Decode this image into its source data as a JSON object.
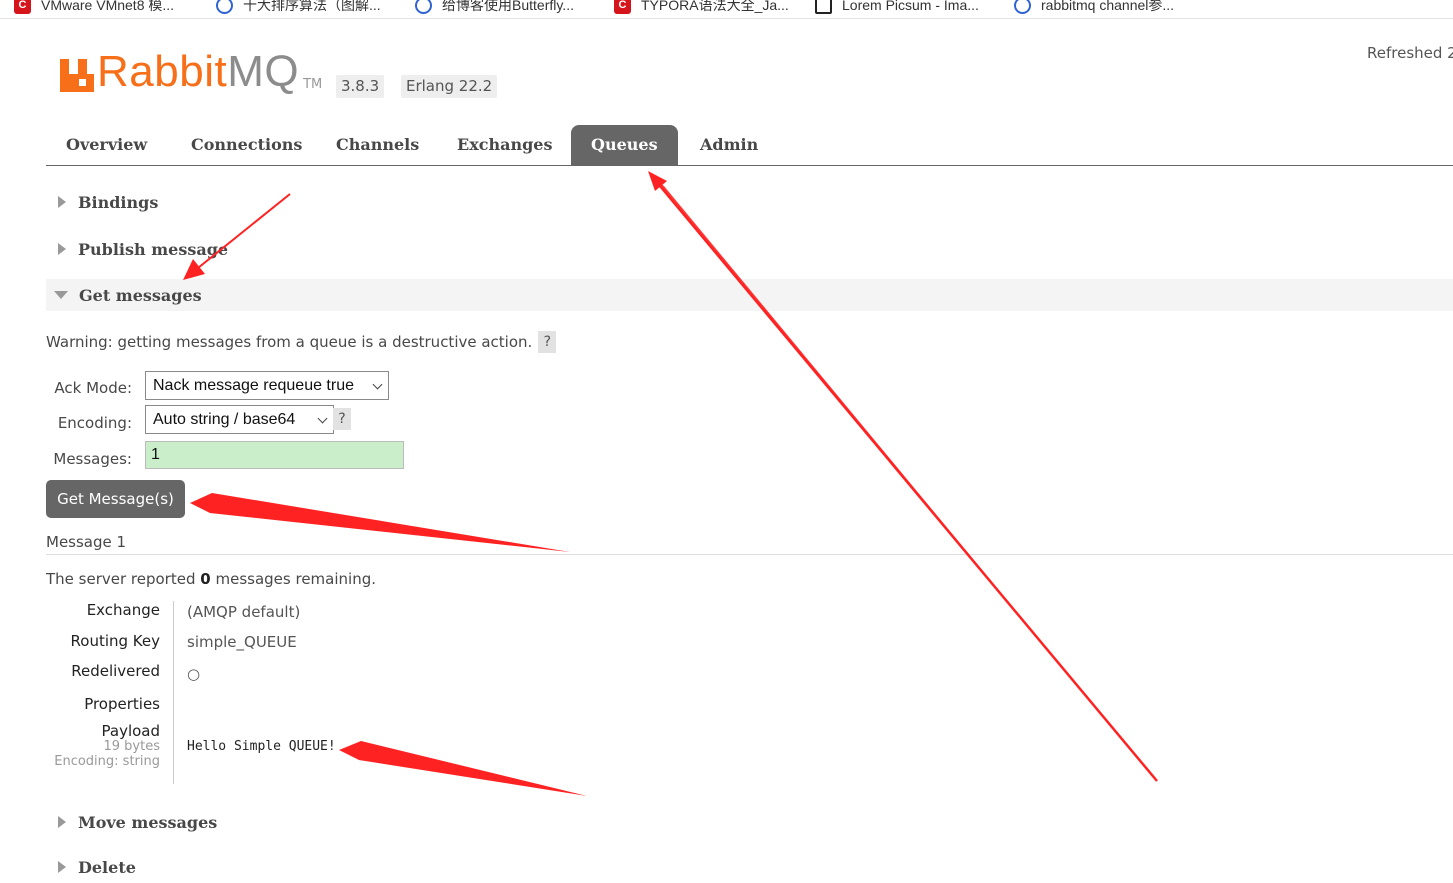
{
  "bookmarks": [
    {
      "label": "VMware VMnet8 模...",
      "icon": "red-c-icon"
    },
    {
      "label": "十大排序算法（图解...",
      "icon": "blue-circle-icon"
    },
    {
      "label": "给博客使用Butterfly...",
      "icon": "blue-circle-icon"
    },
    {
      "label": "TYPORA语法大全_Ja...",
      "icon": "red-c-icon"
    },
    {
      "label": "Lorem Picsum - Ima...",
      "icon": "image-icon"
    },
    {
      "label": "rabbitmq channel参...",
      "icon": "blue-circle-icon"
    }
  ],
  "header": {
    "logo_rabbit": "Rabbit",
    "logo_mq": "MQ",
    "logo_tm": "TM",
    "version": "3.8.3",
    "erlang": "Erlang 22.2",
    "refreshed": "Refreshed 2"
  },
  "tabs": [
    {
      "label": "Overview"
    },
    {
      "label": "Connections"
    },
    {
      "label": "Channels"
    },
    {
      "label": "Exchanges"
    },
    {
      "label": "Queues",
      "active": true
    },
    {
      "label": "Admin"
    }
  ],
  "sections": {
    "bindings": "Bindings",
    "publish": "Publish message",
    "get": "Get messages",
    "move": "Move messages",
    "delete": "Delete"
  },
  "get_messages": {
    "warning": "Warning: getting messages from a queue is a destructive action.",
    "help": "?",
    "ack_mode_label": "Ack Mode:",
    "ack_mode_value": "Nack message requeue true",
    "encoding_label": "Encoding:",
    "encoding_value": "Auto string / base64",
    "messages_label": "Messages:",
    "messages_value": "1",
    "button": "Get Message(s)"
  },
  "message": {
    "title": "Message 1",
    "report_prefix": "The server reported",
    "report_count": "0",
    "report_suffix": "messages remaining.",
    "exchange_key": "Exchange",
    "exchange_val": "(AMQP default)",
    "routing_key": "Routing Key",
    "routing_val": "simple_QUEUE",
    "redelivered_key": "Redelivered",
    "redelivered_val": "○",
    "properties_key": "Properties",
    "payload_key": "Payload",
    "payload_bytes": "19 bytes",
    "payload_encoding": "Encoding: string",
    "payload_val": "Hello Simple QUEUE!"
  },
  "colors": {
    "brand_orange": "#f76f19",
    "active_tab": "#666666",
    "annotation_red": "#ff2222",
    "input_green": "#c9eec9"
  }
}
